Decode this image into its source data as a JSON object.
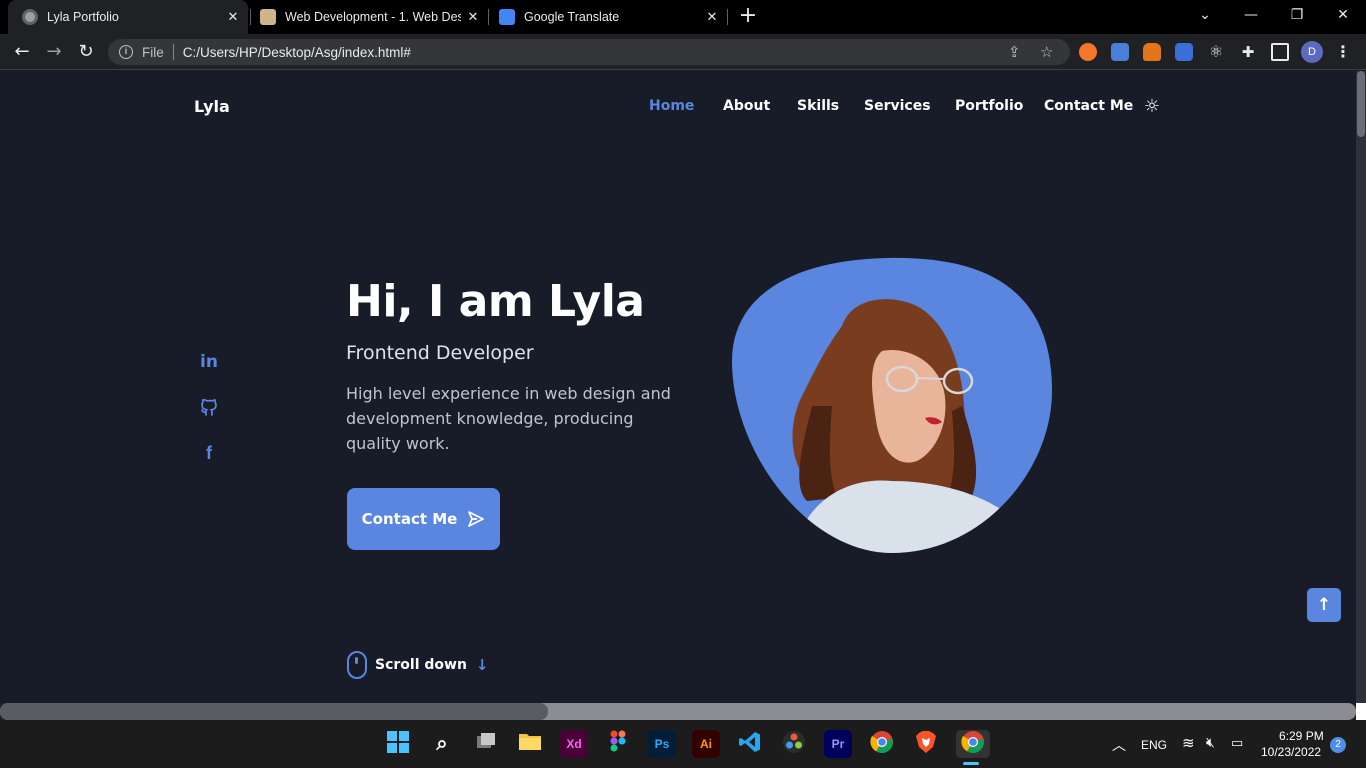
{
  "browser": {
    "tabs": [
      {
        "title": "Lyla Portfolio",
        "active": true,
        "icon": "globe-icon"
      },
      {
        "title": "Web Development - 1. Web Desi",
        "active": false,
        "icon": "site-icon"
      },
      {
        "title": "Google Translate",
        "active": false,
        "icon": "google-translate-icon"
      }
    ],
    "address": {
      "scheme_label": "File",
      "url": "C:/Users/HP/Desktop/Asg/index.html#"
    },
    "profile_initial": "D"
  },
  "site": {
    "logo": "Lyla",
    "nav": {
      "items": [
        "Home",
        "About",
        "Skills",
        "Services",
        "Portfolio",
        "Contact Me"
      ],
      "active": "Home"
    },
    "socials": [
      "linkedin-icon",
      "github-icon",
      "facebook-icon"
    ],
    "hero": {
      "title": "Hi, I am Lyla",
      "subtitle": "Frontend Developer",
      "description": "High level experience in web design and development knowledge, producing quality work.",
      "cta_label": "Contact Me"
    },
    "scroll_label": "Scroll down",
    "accent_color": "#5a86e0",
    "background_color": "#181c28"
  },
  "taskbar": {
    "apps": [
      "windows-start-icon",
      "search-icon",
      "task-view-icon",
      "file-explorer-icon",
      "adobe-xd-icon",
      "figma-icon",
      "photoshop-icon",
      "illustrator-icon",
      "vscode-icon",
      "davinci-resolve-icon",
      "premiere-pro-icon",
      "chrome-icon",
      "brave-icon",
      "chrome-active-icon"
    ],
    "xd_label": "Xd",
    "ps_label": "Ps",
    "ai_label": "Ai",
    "pr_label": "Pr",
    "language": "ENG",
    "time": "6:29 PM",
    "date": "10/23/2022",
    "notifications": "2"
  }
}
